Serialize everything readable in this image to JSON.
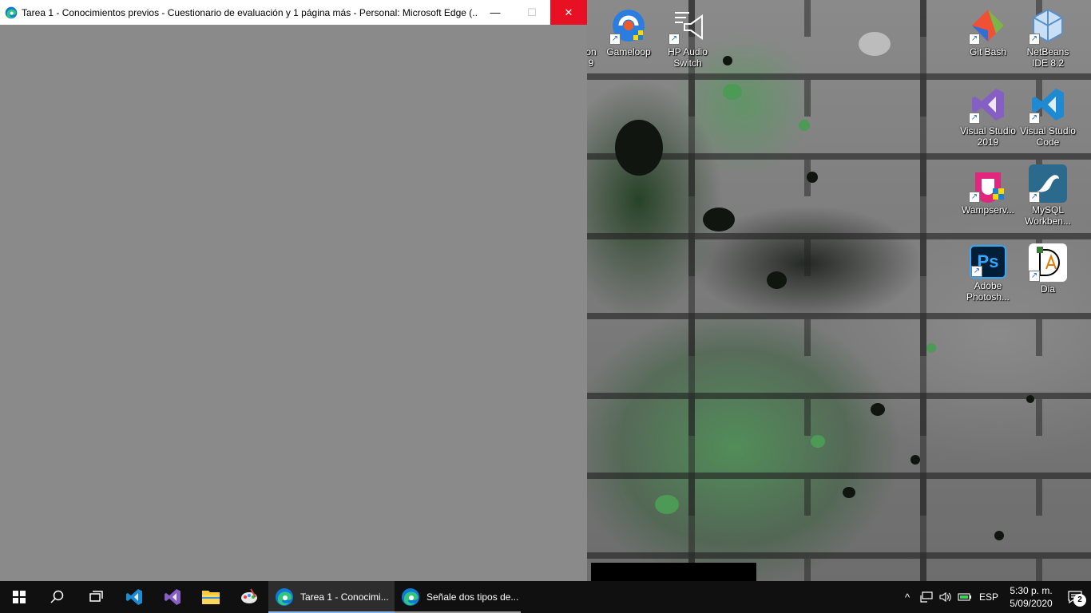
{
  "window": {
    "title": "Tarea 1 - Conocimientos previos - Cuestionario de evaluación y 1 página más - Personal: Microsoft Edge (...",
    "minimize_glyph": "—",
    "maximize_glyph": "☐",
    "close_glyph": "✕"
  },
  "desktop_icons": {
    "partial": {
      "line1": "on",
      "line2": "9"
    },
    "gameloop": {
      "label": "Gameloop"
    },
    "hp_audio": {
      "label": "HP Audio Switch"
    },
    "git_bash": {
      "label": "Git Bash"
    },
    "netbeans": {
      "label": "NetBeans IDE 8.2"
    },
    "vs2019": {
      "label": "Visual Studio 2019"
    },
    "vscode": {
      "label": "Visual Studio Code"
    },
    "wampserver": {
      "label": "Wampserv..."
    },
    "mysql": {
      "label": "MySQL Workben..."
    },
    "photoshop": {
      "label": "Adobe Photosh...",
      "glyph": "Ps"
    },
    "dia": {
      "label": "Dia"
    }
  },
  "taskbar": {
    "apps": [
      {
        "label": "Tarea 1 - Conocimi...",
        "active": true
      },
      {
        "label": "Señale dos tipos de...",
        "active": false
      }
    ],
    "tray": {
      "chevron": "^",
      "language": "ESP",
      "time": "5:30 p. m.",
      "date": "5/09/2020",
      "notification_count": "2"
    }
  },
  "colors": {
    "close_red": "#e81123",
    "taskbar": "#101010",
    "window_body": "#8a8a8a",
    "active_indicator": "#8bb4e6"
  }
}
